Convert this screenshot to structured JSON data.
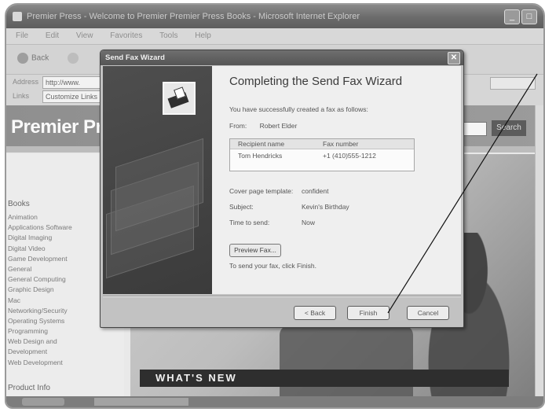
{
  "browser": {
    "title": "Premier Press - Welcome to Premier Premier Press Books - Microsoft Internet Explorer",
    "menu": [
      "File",
      "Edit",
      "View",
      "Favorites",
      "Tools",
      "Help"
    ],
    "back_label": "Back",
    "address_label": "Address",
    "address_value": "http://www.",
    "links_label": "Links",
    "links_value": "Customize Links"
  },
  "site": {
    "logo": "Premier Pre",
    "search_button": "Search",
    "sidebar_heading": "Books",
    "categories": [
      "Animation",
      "Applications Software",
      "Digital Imaging",
      "Digital Video",
      "Game Development",
      "General",
      "General Computing",
      "Graphic Design",
      "Mac",
      "Networking/Security",
      "Operating Systems",
      "Programming",
      "Web Design and",
      "Development",
      "Web Development"
    ],
    "footer_heading": "Product Info",
    "whats_new": "WHAT'S NEW"
  },
  "wizard": {
    "title": "Send Fax Wizard",
    "heading": "Completing the Send Fax Wizard",
    "intro": "You have successfully created a fax as follows:",
    "from_label": "From:",
    "from_value": "Robert Elder",
    "recipients": {
      "header_name": "Recipient name",
      "header_number": "Fax number",
      "name": "Tom Hendricks",
      "number": "+1 (410)555-1212"
    },
    "cover_label": "Cover page template:",
    "cover_value": "confident",
    "subject_label": "Subject:",
    "subject_value": "Kevin's Birthday",
    "time_label": "Time to send:",
    "time_value": "Now",
    "preview_button": "Preview Fax...",
    "hint": "To send your fax, click Finish.",
    "back_button": "< Back",
    "finish_button": "Finish",
    "cancel_button": "Cancel"
  }
}
